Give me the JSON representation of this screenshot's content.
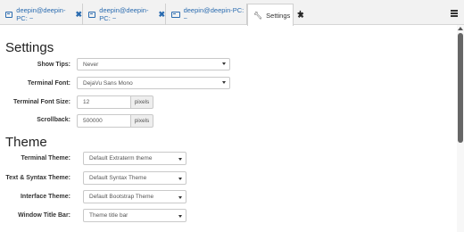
{
  "tabs": [
    {
      "label": "deepin@deepin-PC: ~",
      "icon": "terminal-icon"
    },
    {
      "label": "deepin@deepin-PC: ~",
      "icon": "terminal-icon"
    },
    {
      "label": "deepin@deepin-PC: ~",
      "icon": "terminal-icon"
    },
    {
      "label": "Settings",
      "icon": "wrench-icon"
    }
  ],
  "toolbar": {
    "new_tab": "+",
    "close_glyph": "✖",
    "chevron": "⌄"
  },
  "settings": {
    "heading": "Settings",
    "show_tips": {
      "label": "Show Tips:",
      "value": "Never"
    },
    "terminal_font": {
      "label": "Terminal Font:",
      "value": "DejaVu Sans Mono"
    },
    "terminal_font_size": {
      "label": "Terminal Font Size:",
      "value": "12",
      "unit": "pixels"
    },
    "scrollback": {
      "label": "Scrollback:",
      "value": "500000",
      "unit": "pixels"
    }
  },
  "theme": {
    "heading": "Theme",
    "terminal_theme": {
      "label": "Terminal Theme:",
      "value": "Default Extraterm theme"
    },
    "text_syntax_theme": {
      "label": "Text & Syntax Theme:",
      "value": "Default Syntax Theme"
    },
    "interface_theme": {
      "label": "Interface Theme:",
      "value": "Default Bootstrap Theme"
    },
    "window_title_bar": {
      "label": "Window Title Bar:",
      "value": "Theme title bar"
    }
  },
  "colors": {
    "accent": "#2b6cb0",
    "scroll_thumb": "#666666"
  }
}
